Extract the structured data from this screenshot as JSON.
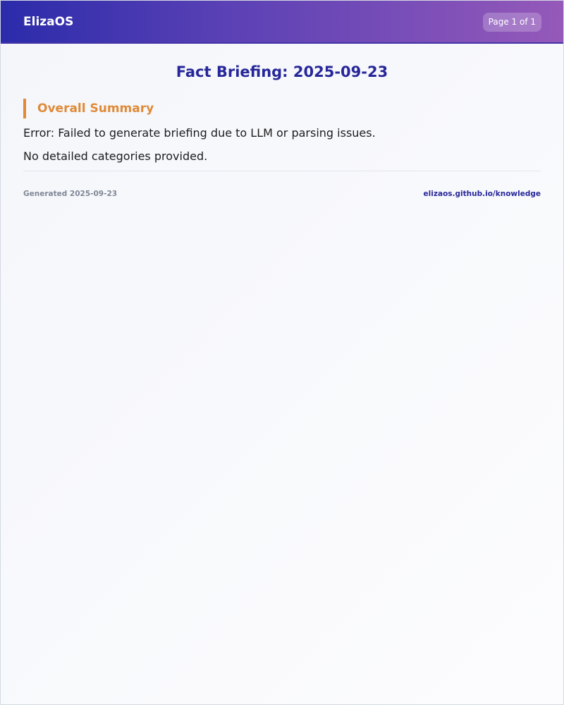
{
  "header": {
    "brand": "ElizaOS",
    "page_indicator": "Page 1 of 1"
  },
  "document": {
    "title": "Fact Briefing: 2025-09-23",
    "sections": [
      {
        "heading": "Overall Summary",
        "paragraphs": [
          "Error: Failed to generate briefing due to LLM or parsing issues.",
          "No detailed categories provided."
        ]
      }
    ]
  },
  "footer": {
    "generated": "Generated 2025-09-23",
    "link": "elizaos.github.io/knowledge"
  },
  "colors": {
    "header_gradient_start": "#2b2baa",
    "header_gradient_end": "#9559b9",
    "title": "#27279a",
    "section_accent": "#e08a38",
    "footer_muted": "#7f8796"
  }
}
